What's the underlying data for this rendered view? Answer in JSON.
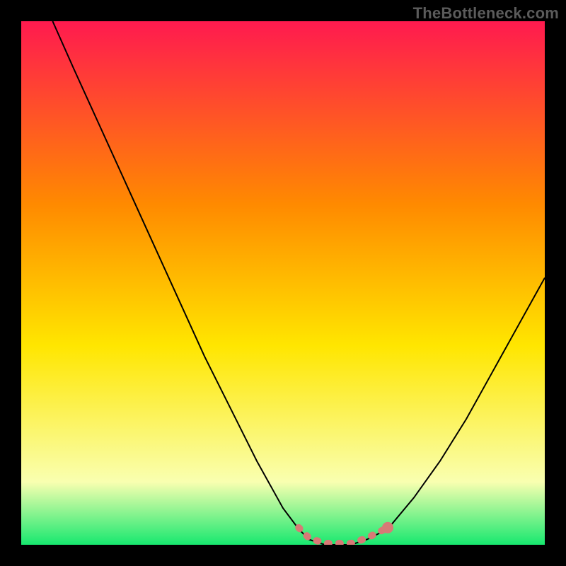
{
  "watermark": "TheBottleneck.com",
  "colors": {
    "frame": "#000000",
    "curve": "#000000",
    "accent": "#d77a76",
    "gradient_top": "#ff1a4f",
    "gradient_mid1": "#ff8a00",
    "gradient_mid2": "#ffe600",
    "gradient_low": "#f9ffb0",
    "gradient_bottom": "#17e86f"
  },
  "chart_data": {
    "type": "line",
    "title": "",
    "xlabel": "",
    "ylabel": "",
    "xlim": [
      0,
      100
    ],
    "ylim": [
      0,
      100
    ],
    "grid": false,
    "series": [
      {
        "name": "bottleneck_curve",
        "x": [
          6,
          10,
          15,
          20,
          25,
          30,
          35,
          40,
          45,
          50,
          53,
          55,
          58,
          60,
          63,
          66,
          70,
          75,
          80,
          85,
          90,
          95,
          100
        ],
        "values": [
          100,
          91,
          80,
          69,
          58,
          47,
          36,
          26,
          16,
          7,
          3,
          1,
          0,
          0,
          0,
          1,
          3,
          9,
          16,
          24,
          33,
          42,
          51
        ]
      }
    ],
    "accent_region": {
      "note": "flat valley highlighted with dashed/dotted pink band",
      "x_start": 53,
      "x_end": 70,
      "y": 0
    }
  }
}
